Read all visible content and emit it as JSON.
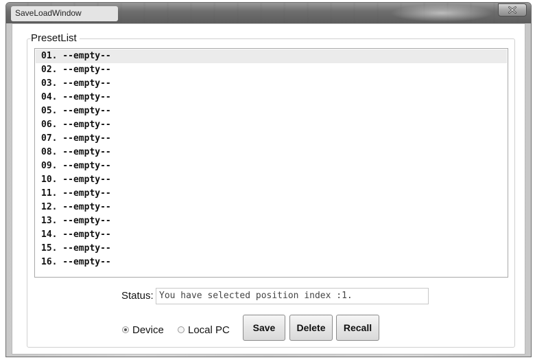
{
  "window": {
    "title": "SaveLoadWindow"
  },
  "preset_group": {
    "label": "PresetList"
  },
  "preset_list": {
    "items": [
      "01. --empty--",
      "02. --empty--",
      "03. --empty--",
      "04. --empty--",
      "05. --empty--",
      "06. --empty--",
      "07. --empty--",
      "08. --empty--",
      "09. --empty--",
      "10. --empty--",
      "11. --empty--",
      "12. --empty--",
      "13. --empty--",
      "14. --empty--",
      "15. --empty--",
      "16. --empty--"
    ],
    "selected_index": 0
  },
  "status": {
    "label": "Status:",
    "value": "You have selected position index :1."
  },
  "target": {
    "options": [
      "Device",
      "Local PC"
    ],
    "selected": "Device"
  },
  "buttons": {
    "save": "Save",
    "delete": "Delete",
    "recall": "Recall"
  },
  "icons": {
    "close": "close-icon"
  }
}
